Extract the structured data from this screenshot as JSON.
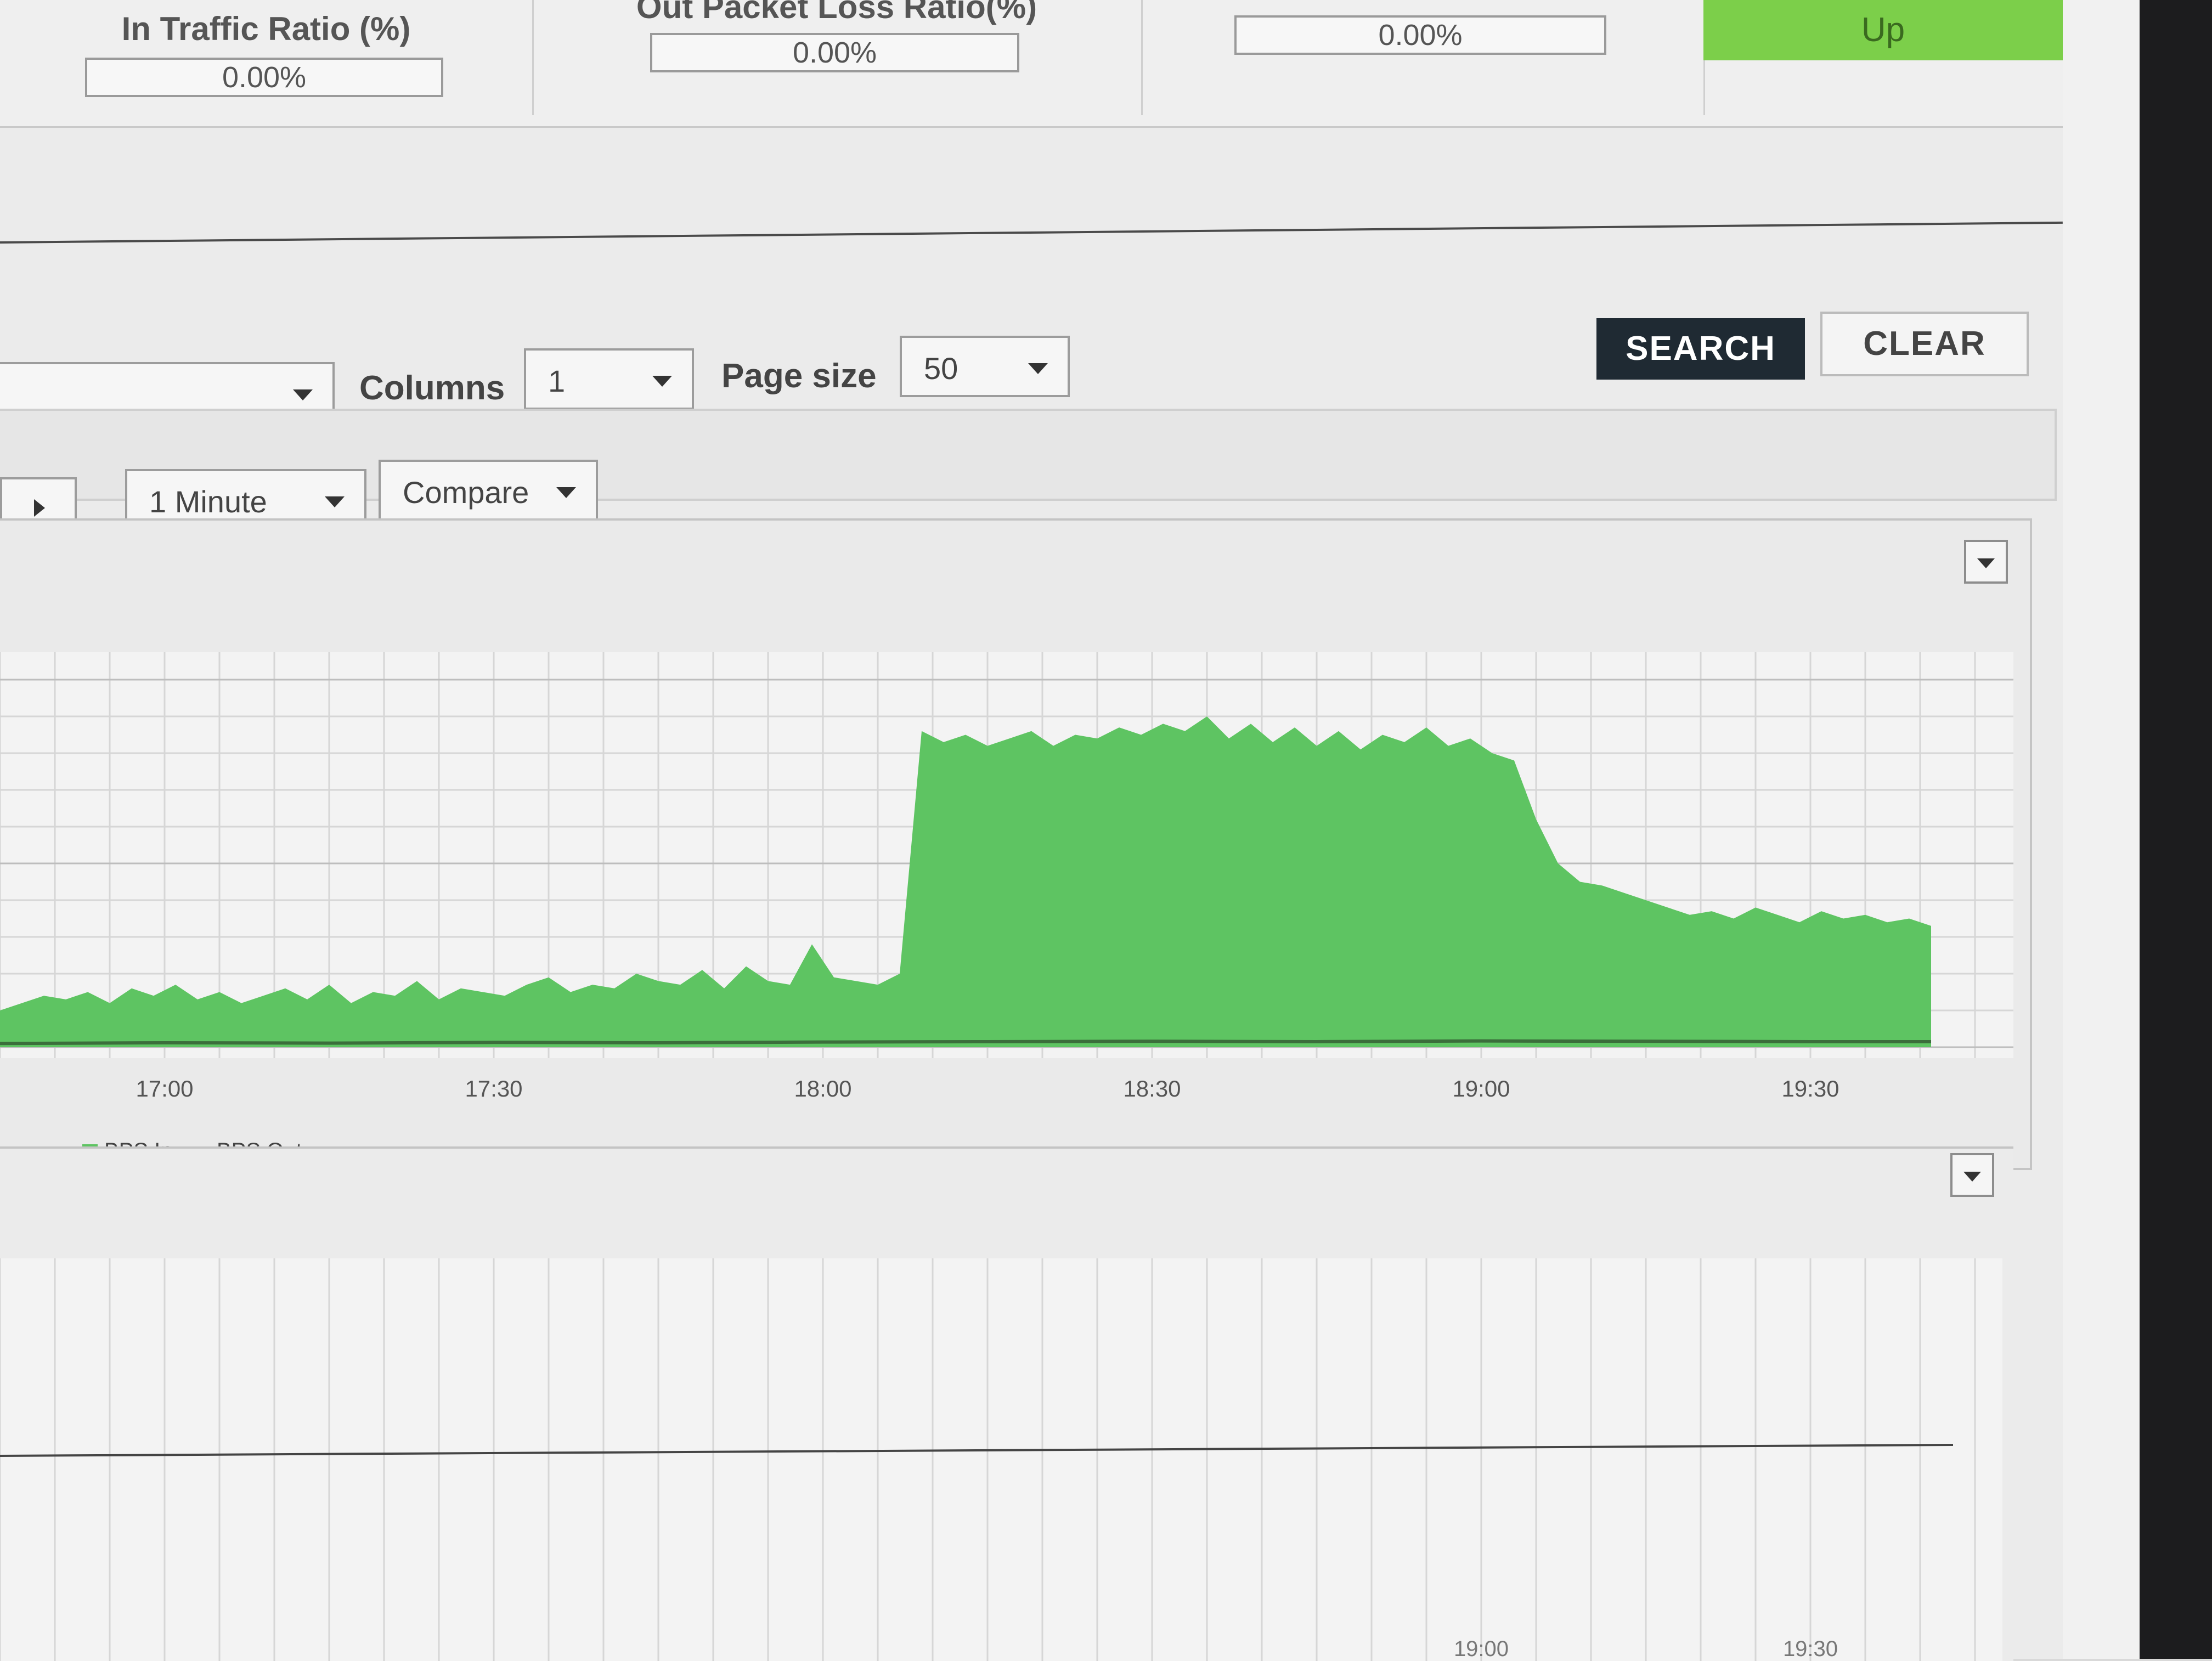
{
  "stats": {
    "in_traffic_ratio_label": "In Traffic Ratio (%)",
    "in_traffic_ratio_value": "0.00%",
    "out_packet_loss_label": "Out Packet Loss Ratio(%)",
    "out_packet_loss_value": "0.00%",
    "third_value": "0.00%",
    "status": "Up",
    "status_color": "#7ccf4a"
  },
  "toolbar": {
    "columns_label": "Columns",
    "columns_value": "1",
    "page_size_label": "Page size",
    "page_size_value": "50",
    "search_label": "SEARCH",
    "clear_label": "CLEAR",
    "interval_value": "1 Minute",
    "compare_label": "Compare"
  },
  "chart_data": {
    "type": "area",
    "x_ticks": [
      "17:00",
      "17:30",
      "18:00",
      "18:30",
      "19:00",
      "19:30"
    ],
    "x_tick_minutes": [
      0,
      30,
      60,
      90,
      120,
      150
    ],
    "x_range_minutes": [
      -15,
      165
    ],
    "y_range": [
      0,
      100
    ],
    "grid": true,
    "legend": "bottom-left",
    "series": [
      {
        "name": "BPS In",
        "color": "#5ec462",
        "style": "area",
        "x": [
          -15,
          -13,
          -11,
          -9,
          -7,
          -5,
          -3,
          -1,
          1,
          3,
          5,
          7,
          9,
          11,
          13,
          15,
          17,
          19,
          21,
          23,
          25,
          27,
          29,
          31,
          33,
          35,
          37,
          39,
          41,
          43,
          45,
          47,
          49,
          51,
          53,
          55,
          57,
          59,
          61,
          63,
          65,
          67,
          69,
          71,
          73,
          75,
          77,
          79,
          81,
          83,
          85,
          87,
          89,
          91,
          93,
          95,
          97,
          99,
          101,
          103,
          105,
          107,
          109,
          111,
          113,
          115,
          117,
          119,
          121,
          123,
          125,
          127,
          129,
          131,
          133,
          135,
          137,
          139,
          141,
          143,
          145,
          147,
          149,
          151,
          153,
          155,
          157,
          159,
          161
        ],
        "values": [
          10,
          12,
          14,
          13,
          15,
          12,
          16,
          14,
          17,
          13,
          15,
          12,
          14,
          16,
          13,
          17,
          12,
          15,
          14,
          18,
          13,
          16,
          15,
          14,
          17,
          19,
          15,
          17,
          16,
          20,
          18,
          17,
          21,
          16,
          22,
          18,
          17,
          28,
          19,
          18,
          17,
          20,
          86,
          83,
          85,
          82,
          84,
          86,
          82,
          85,
          84,
          87,
          85,
          88,
          86,
          90,
          84,
          88,
          83,
          87,
          82,
          86,
          81,
          85,
          83,
          87,
          82,
          84,
          80,
          78,
          62,
          50,
          45,
          44,
          42,
          40,
          38,
          36,
          37,
          35,
          38,
          36,
          34,
          37,
          35,
          36,
          34,
          35,
          33
        ]
      },
      {
        "name": "BPS Out",
        "color": "#3b6e3b",
        "style": "line",
        "x": [
          -15,
          0,
          15,
          30,
          45,
          60,
          75,
          90,
          105,
          120,
          135,
          150,
          161
        ],
        "values": [
          1,
          1.2,
          1.1,
          1.3,
          1.2,
          1.4,
          1.5,
          1.6,
          1.5,
          1.7,
          1.6,
          1.5,
          1.5
        ]
      }
    ]
  },
  "chart2": {
    "x_ticks": [
      "19:00",
      "19:30"
    ]
  }
}
